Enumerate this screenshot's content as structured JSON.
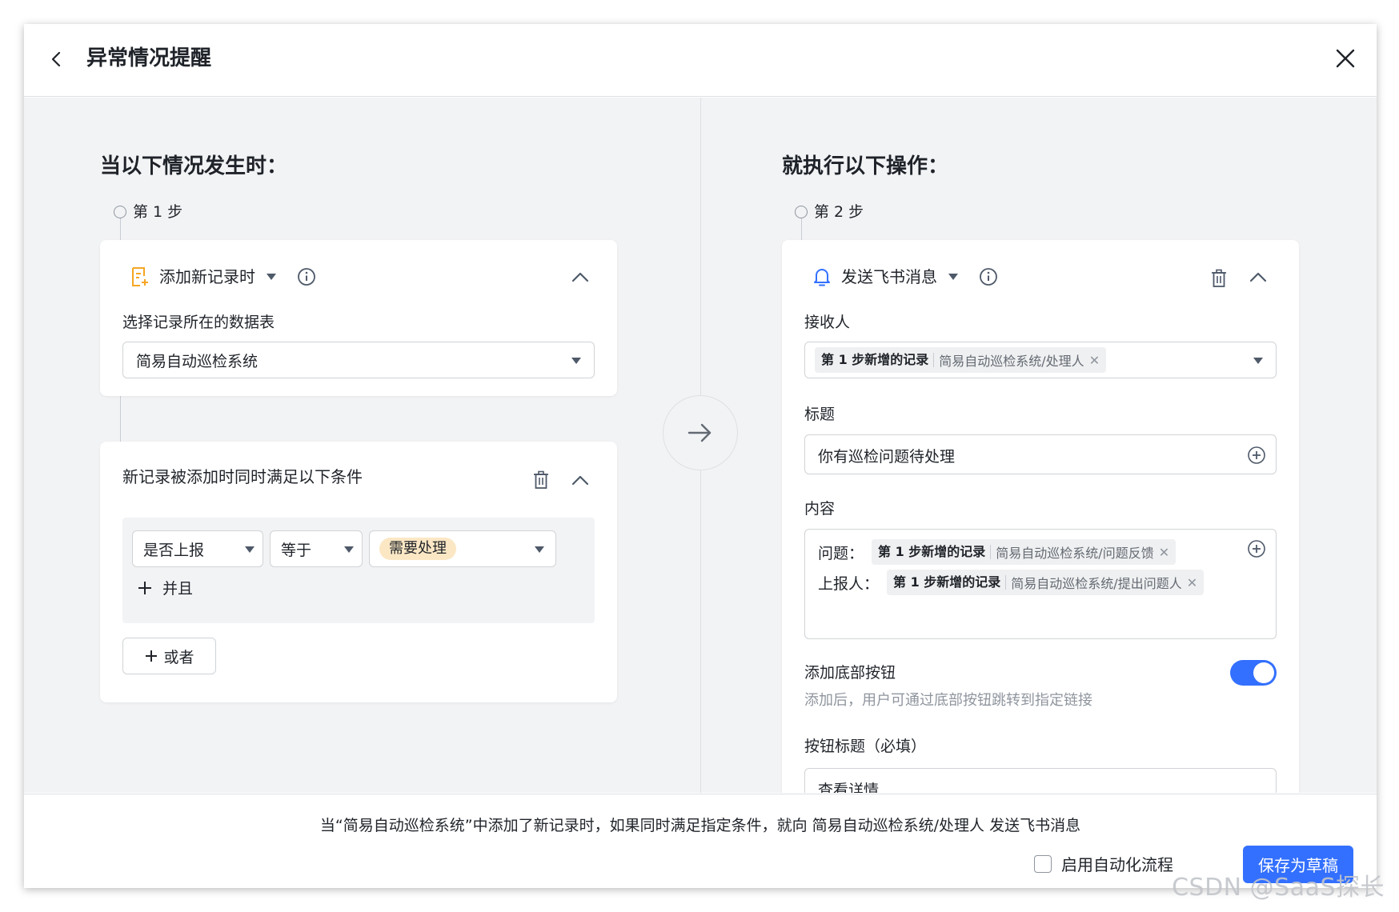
{
  "header": {
    "title": "异常情况提醒"
  },
  "left": {
    "section_title": "当以下情况发生时：",
    "step_label": "第 1 步",
    "trigger": {
      "name": "添加新记录时",
      "table_label": "选择记录所在的数据表",
      "table_value": "简易自动巡检系统"
    },
    "conditions": {
      "title": "新记录被添加时同时满足以下条件",
      "field": "是否上报",
      "operator": "等于",
      "value": "需要处理",
      "and_label": "并且",
      "or_label": "或者"
    }
  },
  "right": {
    "section_title": "就执行以下操作：",
    "step_label": "第 2 步",
    "action": {
      "name": "发送飞书消息"
    },
    "recipient": {
      "label": "接收人",
      "chip_source": "第 1 步新增的记录",
      "chip_field": "简易自动巡检系统/处理人"
    },
    "title_field": {
      "label": "标题",
      "value": "你有巡检问题待处理"
    },
    "content": {
      "label": "内容",
      "line1_prefix": "问题：",
      "line1_chip_source": "第 1 步新增的记录",
      "line1_chip_field": "简易自动巡检系统/问题反馈",
      "line2_prefix": "上报人：",
      "line2_chip_source": "第 1 步新增的记录",
      "line2_chip_field": "简易自动巡检系统/提出问题人"
    },
    "bottom_button": {
      "label": "添加底部按钮",
      "hint": "添加后，用户可通过底部按钮跳转到指定链接",
      "enabled": true,
      "button_title_label": "按钮标题（必填）",
      "button_title_value": "查看详情"
    }
  },
  "footer": {
    "summary": "当“简易自动巡检系统”中添加了新记录时，如果同时满足指定条件，就向 简易自动巡检系统/处理人 发送飞书消息",
    "enable_label": "启用自动化流程",
    "save_label": "保存为草稿"
  },
  "watermark": "CSDN @SaaS探长",
  "colors": {
    "accent": "#3370ff",
    "background": "#f2f3f5",
    "tag_orange": "#fbe7c4",
    "trigger_icon": "#f5a623"
  }
}
